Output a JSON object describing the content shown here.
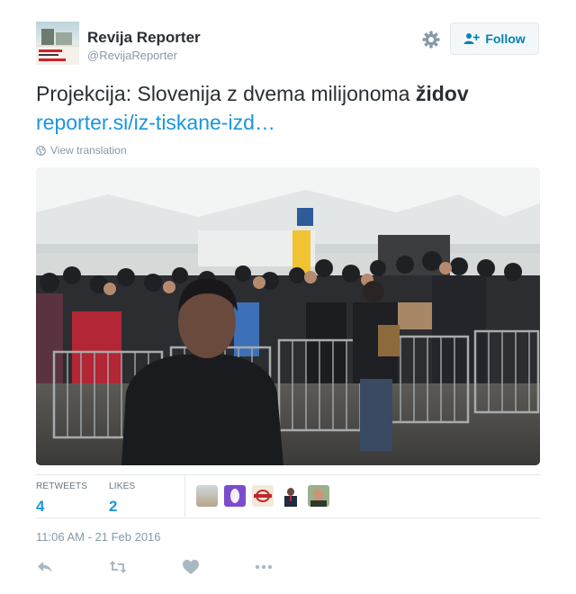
{
  "account": {
    "name": "Revija Reporter",
    "handle": "@RevijaReporter",
    "avatar_text": [
      "BOGASTVO",
      "ŠALEŠKEGA LOBIJA"
    ]
  },
  "header": {
    "follow_label": "Follow"
  },
  "tweet": {
    "text_main": "Projekcija: Slovenija z dvema milijonoma ",
    "text_bold": "židov",
    "link": "reporter.si/iz-tiskane-izd…"
  },
  "translate_label": "View translation",
  "stats": {
    "retweets_label": "RETWEETS",
    "retweets_value": "4",
    "likes_label": "LIKES",
    "likes_value": "2"
  },
  "timestamp": "11:06 AM - 21 Feb 2016",
  "actions": [
    "reply-icon",
    "retweet-icon",
    "like-icon",
    "more-icon"
  ],
  "colors": {
    "accent": "#1b95e0",
    "follow_text": "#0084b4",
    "muted": "#8899a6"
  }
}
